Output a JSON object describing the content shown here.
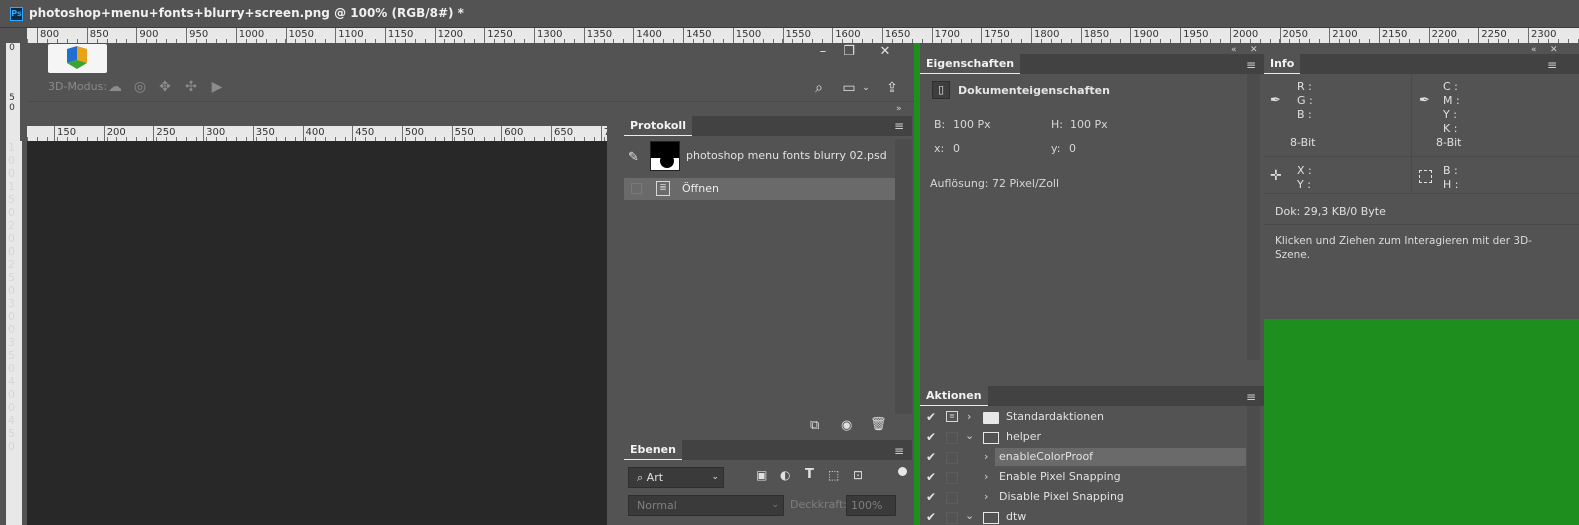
{
  "document": {
    "title": "photoshop+menu+fonts+blurry+screen.png @ 100% (RGB/8#) *",
    "app_badge": "Ps"
  },
  "ruler_top": {
    "labels": [
      "800",
      "850",
      "900",
      "950",
      "1000",
      "1050",
      "1100",
      "1150",
      "1200",
      "1250",
      "1300",
      "1350",
      "1400",
      "1450",
      "1500",
      "1550",
      "1600",
      "1650",
      "1700",
      "1750",
      "1800",
      "1850",
      "1900",
      "1950",
      "2000",
      "2050",
      "2100",
      "2150",
      "2200",
      "2250",
      "2300"
    ]
  },
  "ruler_left": {
    "labels": [
      "0",
      "5 0",
      "1 0 0",
      "1 5 0",
      "2 0 0",
      "2 5 0",
      "3 0 0",
      "3 5 0",
      "4 0 0",
      "4 5 0"
    ]
  },
  "inner_ruler": {
    "labels": [
      "150",
      "200",
      "250",
      "300",
      "350",
      "400",
      "450",
      "500",
      "550",
      "600",
      "650",
      "7"
    ]
  },
  "inner_ruler_left": {
    "labels": [
      "1 0 0",
      "1 5 0",
      "2 0 0",
      "2 5 0",
      "3 0 0",
      "3 5 0",
      "4 0 0",
      "4 5 0"
    ]
  },
  "options_bar": {
    "mode_label": "3D-Modus:",
    "tools": [
      "orbit-icon",
      "roll-icon",
      "pan-icon",
      "slide-icon",
      "zoom-camera-icon"
    ]
  },
  "window_controls": {
    "minimize": "–",
    "restore": "❐",
    "close": "✕"
  },
  "protokoll": {
    "tab": "Protokoll",
    "snapshot_name": "photoshop menu fonts blurry 02.psd",
    "entries": [
      {
        "label": "Öffnen"
      }
    ]
  },
  "ebenen": {
    "tab": "Ebenen",
    "filter_label": "Art",
    "blend_mode": "Normal",
    "opacity_label": "Deckkraft:",
    "opacity_value": "100%"
  },
  "eigenschaften": {
    "tab": "Eigenschaften",
    "header": "Dokumenteigenschaften",
    "b_label": "B:",
    "b_value": "100 Px",
    "h_label": "H:",
    "h_value": "100 Px",
    "x_label": "x:",
    "x_value": "0",
    "y_label": "y:",
    "y_value": "0",
    "resolution": "Auflösung: 72 Pixel/Zoll"
  },
  "aktionen": {
    "tab": "Aktionen",
    "rows": [
      {
        "label": "Standardaktionen",
        "kind": "set",
        "expanded": false
      },
      {
        "label": "helper",
        "kind": "set",
        "expanded": true
      },
      {
        "label": "enableColorProof",
        "kind": "action",
        "selected": true
      },
      {
        "label": "Enable Pixel Snapping",
        "kind": "action"
      },
      {
        "label": "Disable Pixel Snapping",
        "kind": "action"
      },
      {
        "label": "dtw",
        "kind": "set",
        "expanded": true
      }
    ]
  },
  "info": {
    "tab": "Info",
    "rgb_keys": [
      "R :",
      "G :",
      "B :"
    ],
    "cmyk_keys": [
      "C :",
      "M :",
      "Y :",
      "K :"
    ],
    "bit_left": "8-Bit",
    "bit_right": "8-Bit",
    "xy_keys": [
      "X :",
      "Y :"
    ],
    "bh_keys": [
      "B :",
      "H :"
    ],
    "doc_size": "Dok: 29,3 KB/0 Byte",
    "hint": "Klicken und Ziehen zum Interagieren mit der 3D-Szene."
  },
  "colors": {
    "panel_bg": "#535353",
    "canvas_bg": "#282828",
    "green_screen": "#1e8e1e",
    "ps_blue": "#31a8ff"
  }
}
